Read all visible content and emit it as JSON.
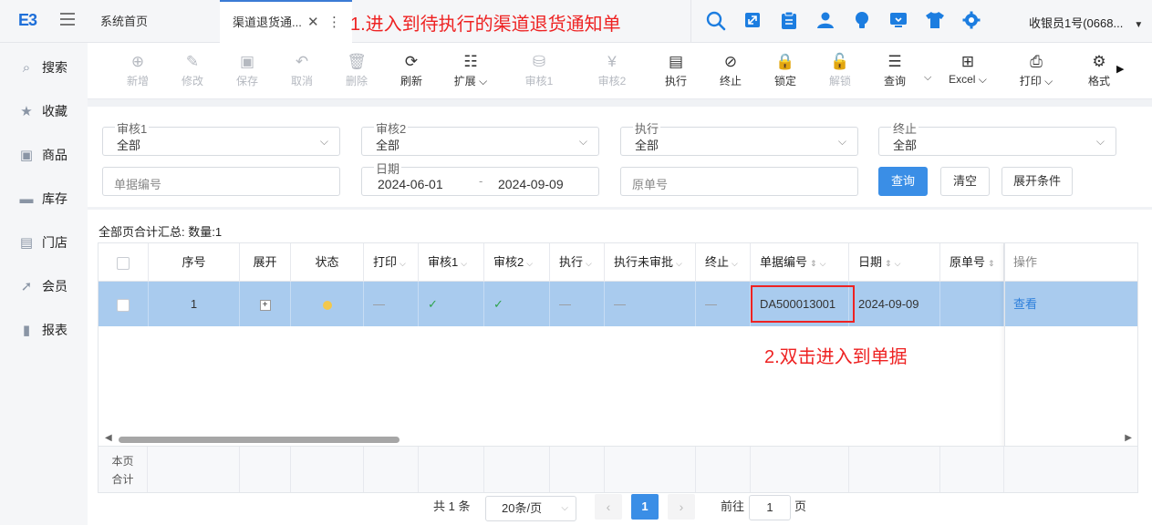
{
  "topbar": {
    "logo": "E3",
    "tabs": [
      {
        "label": "系统首页"
      },
      {
        "label": "渠道退货通...",
        "close": "✕",
        "more": "⋮"
      }
    ],
    "annotation": "1.进入到待执行的渠道退货通知单",
    "icons": [
      "search-icon",
      "expand-icon",
      "clipboard-icon",
      "user-icon",
      "lightbulb-icon",
      "monitor-icon",
      "shirt-icon",
      "gear-icon"
    ],
    "user": "收银员1号(0668..."
  },
  "sidebar": {
    "items": [
      {
        "label": "搜索",
        "icon": "search-icon"
      },
      {
        "label": "收藏",
        "icon": "star-icon"
      },
      {
        "label": "商品",
        "icon": "goods-icon"
      },
      {
        "label": "库存",
        "icon": "warehouse-icon"
      },
      {
        "label": "门店",
        "icon": "store-icon"
      },
      {
        "label": "会员",
        "icon": "rocket-icon"
      },
      {
        "label": "报表",
        "icon": "chart-icon"
      }
    ]
  },
  "toolbar": {
    "buttons": [
      {
        "label": "新增",
        "icon": "⊕",
        "disabled": true
      },
      {
        "label": "修改",
        "icon": "✎",
        "disabled": true
      },
      {
        "label": "保存",
        "icon": "▣",
        "disabled": true
      },
      {
        "label": "取消",
        "icon": "↶",
        "disabled": true
      },
      {
        "label": "删除",
        "icon": "🗑",
        "disabled": true
      },
      {
        "label": "刷新",
        "icon": "⟳",
        "disabled": false
      },
      {
        "label": "扩展 ⌵",
        "icon": "☷",
        "disabled": false
      },
      {
        "label": "审核1",
        "icon": "⛁",
        "disabled": true
      },
      {
        "label": "审核2",
        "icon": "¥",
        "disabled": true
      },
      {
        "label": "执行",
        "icon": "▤",
        "disabled": false
      },
      {
        "label": "终止",
        "icon": "⊘",
        "disabled": false
      },
      {
        "label": "锁定",
        "icon": "🔒",
        "disabled": false
      },
      {
        "label": "解锁",
        "icon": "🔓",
        "disabled": true
      },
      {
        "label": "查询",
        "icon": "☰",
        "disabled": false
      },
      {
        "label": "Excel ⌵",
        "icon": "⊞",
        "disabled": false
      },
      {
        "label": "打印 ⌵",
        "icon": "⎙",
        "disabled": false
      },
      {
        "label": "格式",
        "icon": "⚙",
        "disabled": false
      }
    ],
    "dropdown_caret": "⌵",
    "more_arrow": "▶"
  },
  "filters": {
    "audit1": {
      "label": "审核1",
      "value": "全部"
    },
    "audit2": {
      "label": "审核2",
      "value": "全部"
    },
    "execute": {
      "label": "执行",
      "value": "全部"
    },
    "terminate": {
      "label": "终止",
      "value": "全部"
    },
    "doc_no_placeholder": "单据编号",
    "date": {
      "label": "日期",
      "start": "2024-06-01",
      "separator": "-",
      "end": "2024-09-09"
    },
    "orig_no_placeholder": "原单号",
    "query_button": "查询",
    "clear_button": "清空",
    "expand_button": "展开条件"
  },
  "grid": {
    "summary": "全部页合计汇总:   数量:1",
    "columns": [
      "序号",
      "展开",
      "状态",
      "打印",
      "审核1",
      "审核2",
      "执行",
      "执行未审批",
      "终止",
      "单据编号",
      "日期",
      "原单号",
      "操作"
    ],
    "row": {
      "seq": "1",
      "expand": "+",
      "print": "—",
      "audit1": "✓",
      "audit2": "✓",
      "execute": "—",
      "execute_unapproved": "—",
      "terminate": "—",
      "doc_no": "DA500013001",
      "date": "2024-09-09",
      "orig_no": "",
      "action": "查看"
    },
    "annotation": "2.双击进入到单据",
    "footer_label_1": "本页",
    "footer_label_2": "合计"
  },
  "pagination": {
    "total": "共 1 条",
    "page_size": "20条/页",
    "current_page": "1",
    "goto_label": "前往",
    "goto_value": "1",
    "page_suffix": "页",
    "prev": "‹",
    "next": "›"
  }
}
